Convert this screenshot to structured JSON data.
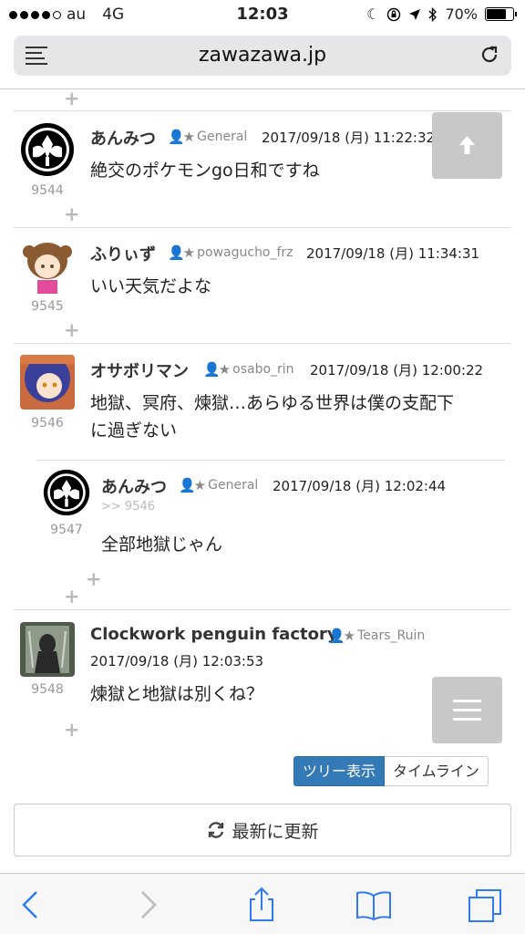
{
  "status": {
    "carrier": "au",
    "network": "4G",
    "time": "12:03",
    "battery": "70%"
  },
  "browser": {
    "url": "zawazawa.jp"
  },
  "posts": [
    {
      "name": "あんみつ",
      "role": "General",
      "date": "2017/09/18 (月) 11:22:32",
      "num": "9544",
      "body": "絶交のポケモンgo日和ですね"
    },
    {
      "name": "ふりぃず",
      "role": "powagucho_frz",
      "date": "2017/09/18 (月) 11:34:31",
      "num": "9545",
      "body": "いい天気だよな"
    },
    {
      "name": "オサボリマン",
      "role": "osabo_rin",
      "date": "2017/09/18 (月) 12:00:22",
      "num": "9546",
      "body_line1": "地獄、冥府、煉獄…あらゆる世界は僕の支配下",
      "body_line2": "に過ぎない"
    },
    {
      "name": "あんみつ",
      "role": "General",
      "date": "2017/09/18 (月) 12:02:44",
      "num": "9547",
      "reply_to": ">> 9546",
      "body": "全部地獄じゃん"
    },
    {
      "name": "Clockwork penguin factory",
      "role": "Tears_Ruin",
      "date": "2017/09/18 (月) 12:03:53",
      "num": "9548",
      "body": "煉獄と地獄は別くね？"
    }
  ],
  "view": {
    "tree": "ツリー表示",
    "timeline": "タイムライン"
  },
  "refresh_label": "最新に更新",
  "colors": {
    "accent": "#337ab7",
    "ios_blue": "#2f7bf5"
  }
}
